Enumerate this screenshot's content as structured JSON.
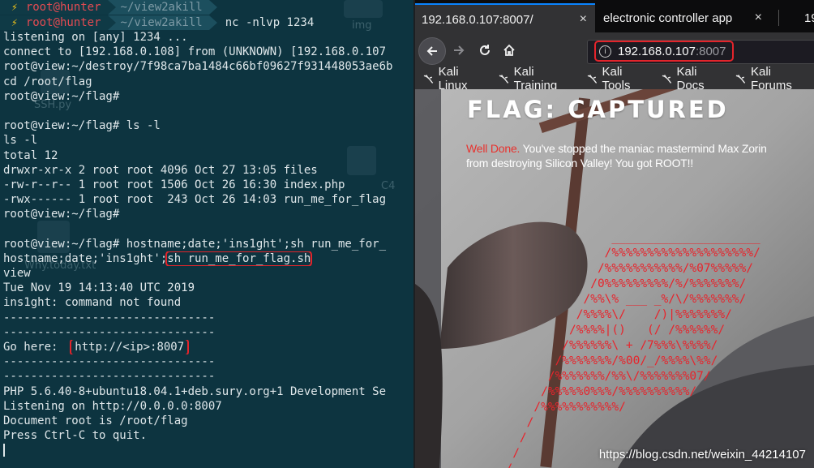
{
  "terminal": {
    "ghost_labels": [
      "img",
      "SSH.py",
      "Why.today.txt",
      "C4"
    ],
    "prompt_rows": [
      {
        "user": "root@hunter",
        "dir": "~/view2akill",
        "cmd": ""
      },
      {
        "user": "root@hunter",
        "dir": "~/view2akill",
        "cmd": "nc -nlvp 1234"
      }
    ],
    "lines": [
      "listening on [any] 1234 ...",
      "connect to [192.168.0.108] from (UNKNOWN) [192.168.0.107",
      "root@view:~/destroy/7f98ca7ba1484c66bf09627f931448053ae6b",
      "cd /root/flag",
      "root@view:~/flag#",
      "",
      "root@view:~/flag# ls -l",
      "ls -l",
      "total 12",
      "drwxr-xr-x 2 root root 4096 Oct 27 13:05 files",
      "-rw-r--r-- 1 root root 1506 Oct 26 16:30 index.php",
      "-rwx------ 1 root root  243 Oct 26 14:03 run_me_for_flag",
      "root@view:~/flag#",
      "",
      "root@view:~/flag# hostname;date;'ins1ght';sh run_me_for_"
    ],
    "hostname_line_prefix": "hostname;date;'ins1ght';",
    "hostname_line_highlight": "sh run_me_for_flag.sh",
    "lines_after": [
      "view",
      "Tue Nov 19 14:13:40 UTC 2019",
      "ins1ght: command not found",
      "-------------------------------",
      "-------------------------------"
    ],
    "go_here_label": "Go here: ",
    "go_here_value": "http://<ip>:8007",
    "lines_end": [
      "-------------------------------",
      "-------------------------------",
      "PHP 5.6.40-8+ubuntu18.04.1+deb.sury.org+1 Development Se",
      "Listening on http://0.0.0.0:8007",
      "Document root is /root/flag",
      "Press Ctrl-C to quit."
    ]
  },
  "browser": {
    "tabs": [
      {
        "label": "192.168.0.107:8007/",
        "close": "×",
        "active": true
      },
      {
        "label": "electronic controller app",
        "close": "×",
        "active": false
      },
      {
        "label": "19",
        "close": "",
        "active": false
      }
    ],
    "url_host": "192.168.0.107",
    "url_port": ":8007",
    "bookmarks": [
      "Kali Linux",
      "Kali Training",
      "Kali Tools",
      "Kali Docs",
      "Kali Forums"
    ],
    "accent": "#0a84ff",
    "highlight_color": "#e3242b"
  },
  "page": {
    "title": "FLAG: CAPTURED",
    "well_done": "Well Done.",
    "message": " You've stopped the maniac mastermind Max Zorin from destroying Silicon Valley! You got ROOT!!",
    "ascii_art": [
      "                 _____________________",
      "                /%%%%%%%%%%%%%%%%%%%%/",
      "               /%%%%%%%%%%%/%07%%%%%/",
      "              /0%%%%%%%%%/%/%%%%%%%/",
      "             /%%\\% ___ _%/\\/%%%%%%%/",
      "            /%%%%\\/    /)|%%%%%%%/",
      "           /%%%%|()   (/ /%%%%%%/",
      "          /%%%%%%\\ + /7%%%\\%%%%/",
      "         /%%%%%%%/%00/_/%%%%\\%%/",
      "        /%%%%%%%/%%\\/%%%%%%%07/",
      "       /%%%%%0%%%/%%%%%%%%%%/",
      "      /%%%%%%%%%%%/",
      "     /",
      "    /",
      "   /",
      "  /"
    ],
    "watermark": "https://blog.csdn.net/weixin_44214107"
  }
}
